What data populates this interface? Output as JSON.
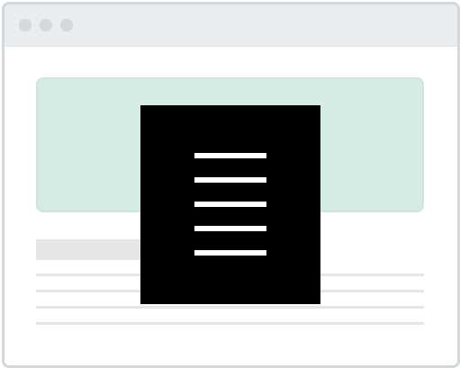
{
  "window": {
    "controls": [
      "window-dot-1",
      "window-dot-2",
      "window-dot-3"
    ]
  },
  "content": {
    "hero_color": "#d6eae6",
    "placeholder_lines": 4
  },
  "overlay": {
    "icon": "document-lines-icon",
    "lines": 5
  }
}
